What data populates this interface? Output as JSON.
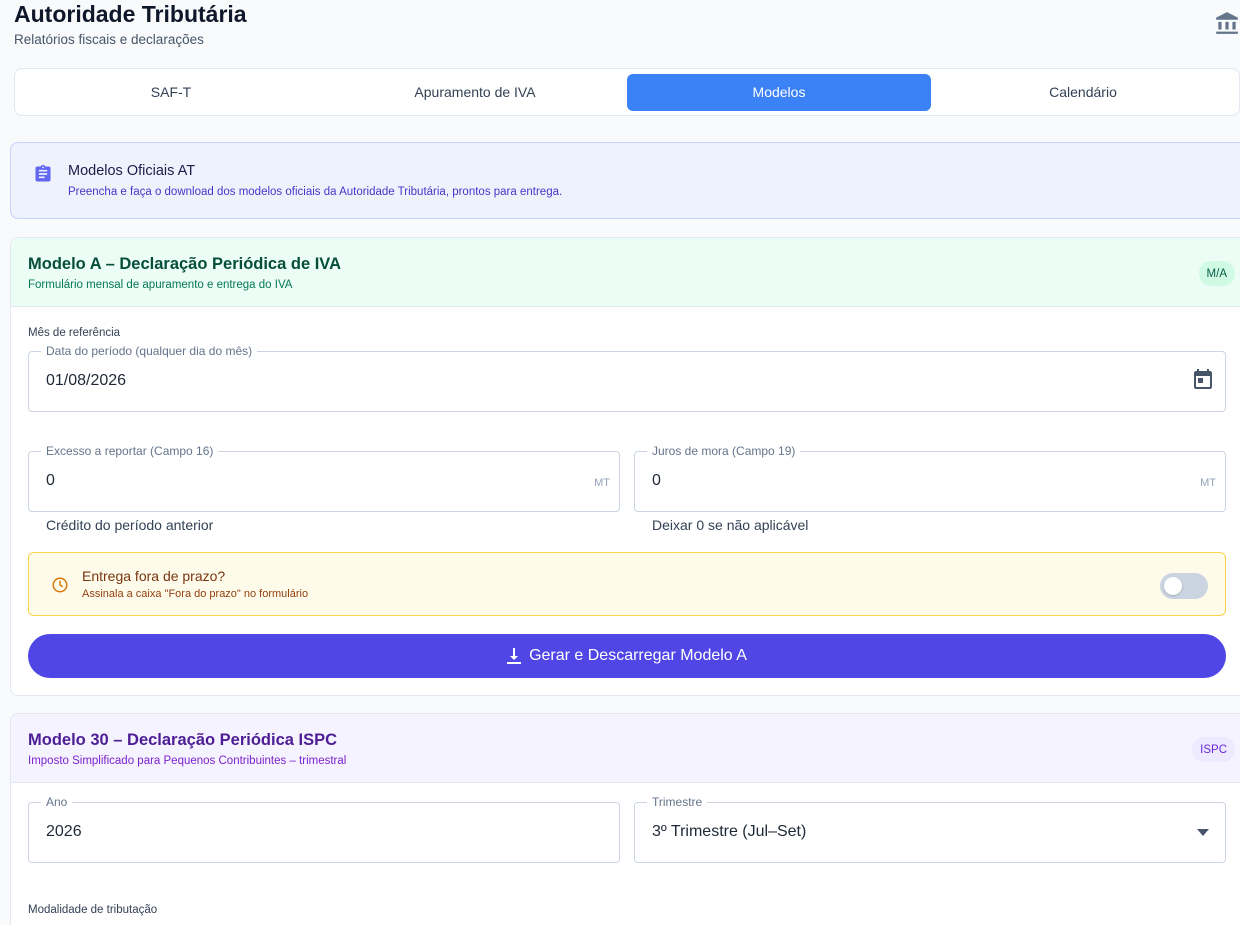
{
  "header": {
    "title": "Autoridade Tributária",
    "subtitle": "Relatórios fiscais e declarações",
    "icon": "bank-icon"
  },
  "tabs": [
    {
      "label": "SAF-T",
      "active": false
    },
    {
      "label": "Apuramento de IVA",
      "active": false
    },
    {
      "label": "Modelos",
      "active": true
    },
    {
      "label": "Calendário",
      "active": false
    }
  ],
  "info": {
    "title": "Modelos Oficiais AT",
    "description": "Preencha e faça o download dos modelos oficiais da Autoridade Tributária, prontos para entrega."
  },
  "modelo_a": {
    "title": "Modelo A – Declaração Periódica de IVA",
    "subtitle": "Formulário mensal de apuramento e entrega do IVA",
    "badge": "M/A",
    "month_label": "Mês de referência",
    "date_field": {
      "label": "Data do período (qualquer dia do mês)",
      "value": "01/08/2026"
    },
    "excess_field": {
      "label": "Excesso a reportar (Campo 16)",
      "value": "0",
      "unit": "MT",
      "helper": "Crédito do período anterior"
    },
    "interest_field": {
      "label": "Juros de mora (Campo 19)",
      "value": "0",
      "unit": "MT",
      "helper": "Deixar 0 se não aplicável"
    },
    "late": {
      "title": "Entrega fora de prazo?",
      "description": "Assinala a caixa \"Fora do prazo\" no formulário",
      "enabled": false
    },
    "generate_button": "Gerar e Descarregar Modelo A"
  },
  "modelo_30": {
    "title": "Modelo 30 – Declaração Periódica ISPC",
    "subtitle": "Imposto Simplificado para Pequenos Contribuintes – trimestral",
    "badge": "ISPC",
    "year_field": {
      "label": "Ano",
      "value": "2026"
    },
    "quarter_field": {
      "label": "Trimestre",
      "value": "3º Trimestre (Jul–Set)"
    },
    "modality_label": "Modalidade de tributação"
  },
  "colors": {
    "accent": "#3b82f6",
    "primary_button": "#4f46e5",
    "modelo_a_header": "#ecfdf5",
    "modelo_30_header": "#f5f3ff",
    "warning_bg": "#fffbeb"
  }
}
